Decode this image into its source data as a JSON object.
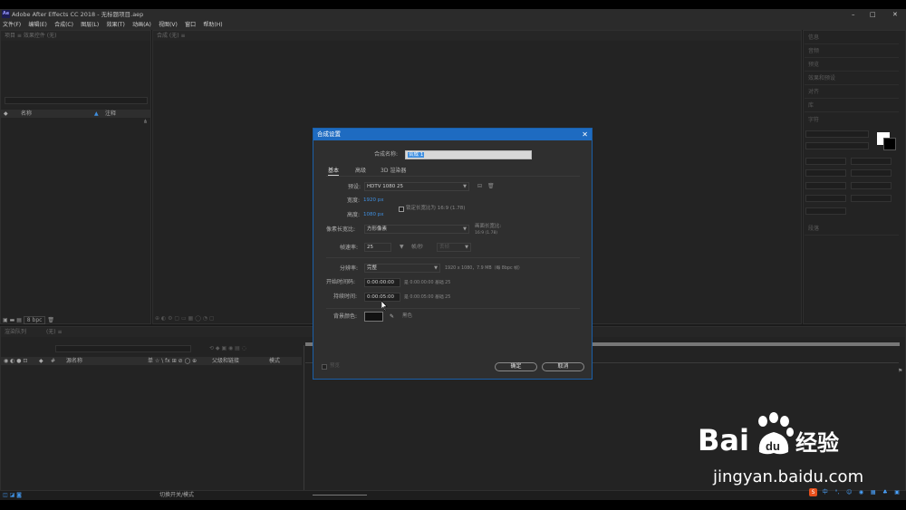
{
  "app": {
    "logo": "Ae",
    "title": "Adobe After Effects CC 2018 - 无标题项目.aep"
  },
  "window_controls": {
    "minimize": "–",
    "maximize": "□",
    "close": "✕"
  },
  "menu": [
    "文件(F)",
    "编辑(E)",
    "合成(C)",
    "图层(L)",
    "效果(T)",
    "动画(A)",
    "视图(V)",
    "窗口",
    "帮助(H)"
  ],
  "project_panel": {
    "tabs": "项目 ≡   效果控件 (无)",
    "col_name": "名称",
    "col_comment": "注释",
    "bpc": "8 bpc"
  },
  "comp_panel": {
    "tab": "合成 (无) ≡"
  },
  "right_panel": {
    "items": [
      "信息",
      "音频",
      "预览",
      "效果和预设",
      "对齐",
      "库",
      "字符",
      "段落",
      "跟踪器",
      "内容识别填充"
    ]
  },
  "timeline": {
    "tab": "渲染队列",
    "tab2": "(无) ≡",
    "cols": [
      "源名称",
      "单 ☆ \\ fx ⊞ ⊘ ◯ ⊕",
      "父级和链接",
      "模式"
    ],
    "toggle_label": "切换开关/模式"
  },
  "dialog": {
    "title": "合成设置",
    "name_label": "合成名称:",
    "name_value": "合成 1",
    "tabs": [
      "基本",
      "高级",
      "3D 渲染器"
    ],
    "preset_label": "预设:",
    "preset_value": "HDTV 1080 25",
    "width_label": "宽度:",
    "width_value": "1920 px",
    "height_label": "高度:",
    "height_value": "1080 px",
    "lock_ratio_label": "锁定长宽比为 16:9 (1.78)",
    "pixel_ratio_label": "像素长宽比:",
    "pixel_ratio_value": "方形像素",
    "frame_ratio_label": "画面长宽比:",
    "frame_ratio_value": "16:9 (1.78)",
    "fps_label": "帧速率:",
    "fps_value": "25",
    "fps_unit": "帧/秒",
    "fps_drop": "丢帧",
    "resolution_label": "分辨率:",
    "resolution_value": "完整",
    "resolution_info": "1920 x 1080，7.9 MB（每 8bpc 帧）",
    "start_tc_label": "开始时间码:",
    "start_tc_value": "0:00:00:00",
    "start_tc_info": "是 0:00:00:00  基础 25",
    "duration_label": "持续时间:",
    "duration_value": "0:00:05:00",
    "duration_info": "是 0:00:05:00  基础 25",
    "bg_label": "背景颜色:",
    "bg_name": "黑色",
    "bg_color": "#111111",
    "preview_label": "预览",
    "ok": "确定",
    "cancel": "取消"
  },
  "watermark": {
    "brand": "Bai",
    "brand2": "du",
    "cn": "经验",
    "url": "jingyan.baidu.com"
  },
  "colors": {
    "accent": "#1e6bc1",
    "panel": "#232323",
    "selection": "#3f8fe0"
  }
}
